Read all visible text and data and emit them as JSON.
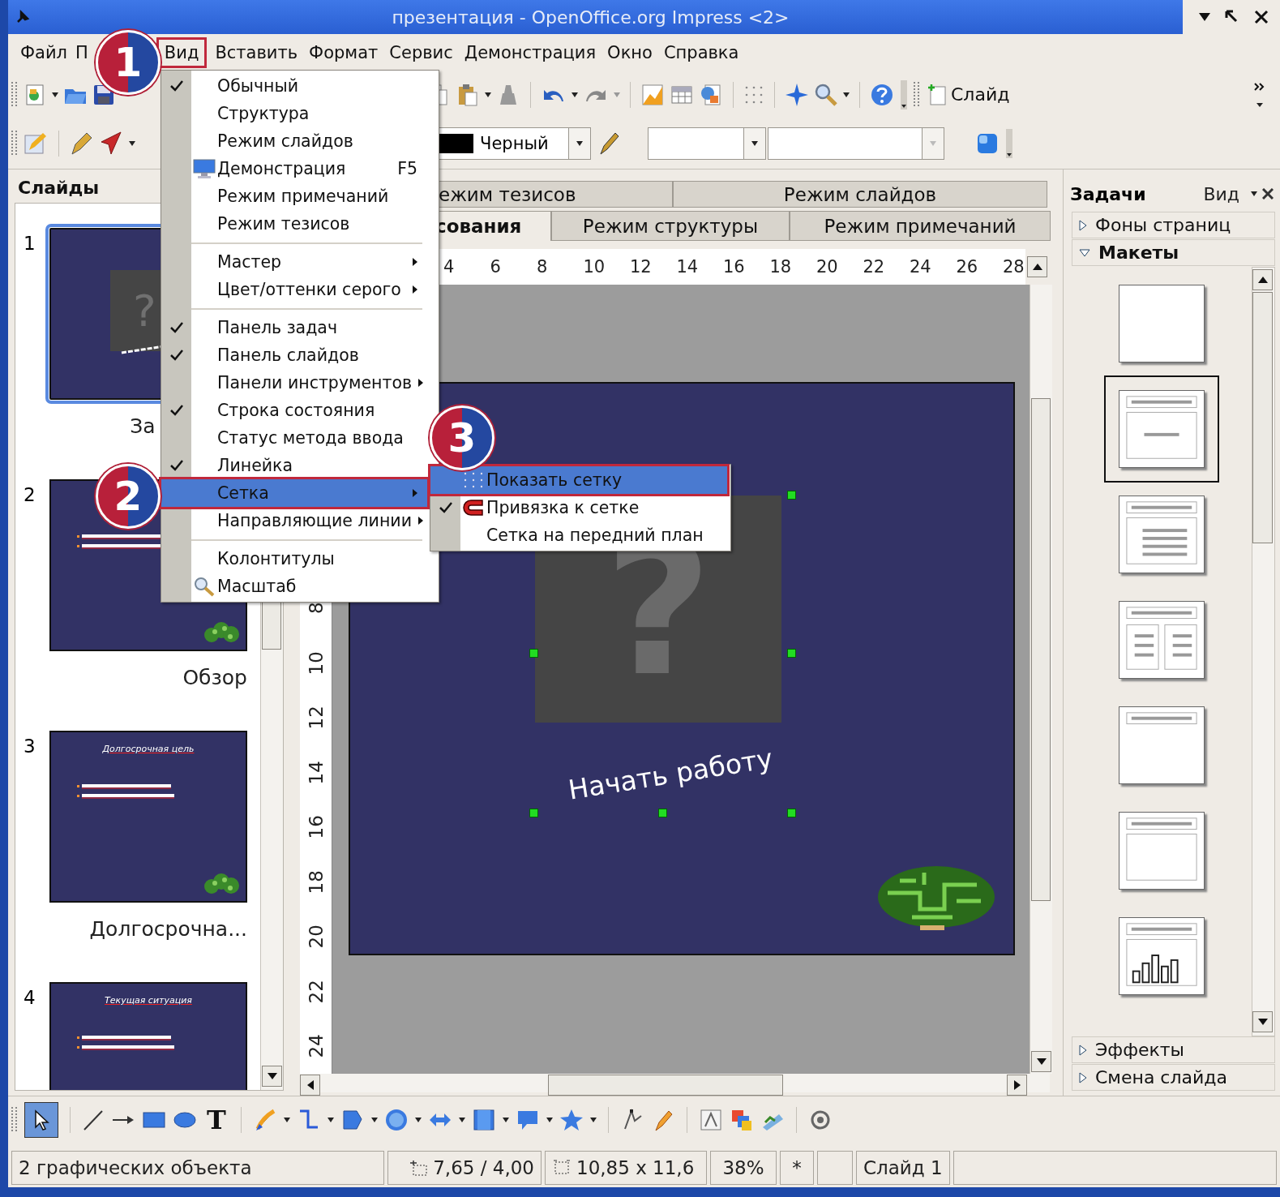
{
  "window": {
    "title": "презентация - OpenOffice.org Impress <2>"
  },
  "menubar": [
    {
      "label": "Файл",
      "annotated": false
    },
    {
      "label": "П",
      "annotated": false
    },
    {
      "label": "Вид",
      "annotated": true
    },
    {
      "label": "Вставить",
      "annotated": false
    },
    {
      "label": "Формат",
      "annotated": false
    },
    {
      "label": "Сервис",
      "annotated": false
    },
    {
      "label": "Демонстрация",
      "annotated": false
    },
    {
      "label": "Окно",
      "annotated": false
    },
    {
      "label": "Справка",
      "annotated": false
    }
  ],
  "toolbar": {
    "new_slide": "Слайд"
  },
  "format_bar": {
    "line_color": "Черный"
  },
  "slides_panel": {
    "title": "Слайды",
    "slides": [
      {
        "number": "1",
        "name": "За",
        "kind": "title",
        "placeholder": "?",
        "selected": true
      },
      {
        "number": "2",
        "name": "Обзор",
        "kind": "content",
        "selected": false
      },
      {
        "number": "3",
        "name": "Долгосрочна...",
        "kind": "content",
        "heading": "Долгосрочная цель",
        "selected": false
      },
      {
        "number": "4",
        "kind": "content",
        "heading": "Текущая ситуация",
        "selected": false
      }
    ]
  },
  "view_tabs": {
    "top": [
      {
        "label": "ежим тезисов",
        "selected": false
      },
      {
        "label": "Режим слайдов",
        "selected": false
      }
    ],
    "bottom": [
      {
        "label": "сования",
        "selected": true
      },
      {
        "label": "Режим структуры",
        "selected": false
      },
      {
        "label": "Режим примечаний",
        "selected": false
      }
    ]
  },
  "rulers": {
    "horizontal": [
      "4",
      "6",
      "8",
      "10",
      "12",
      "14",
      "16",
      "18",
      "20",
      "22",
      "24",
      "26",
      "28"
    ],
    "vertical": [
      "8",
      "10",
      "12",
      "14",
      "16",
      "18",
      "20",
      "22",
      "24"
    ]
  },
  "slide": {
    "placeholder": "?",
    "text": "Начать работу"
  },
  "tasks_panel": {
    "title": "Задачи",
    "view_menu": "Вид",
    "sections": [
      {
        "label": "Фоны страниц",
        "expanded": false
      },
      {
        "label": "Макеты",
        "expanded": true
      }
    ],
    "layouts": [
      {
        "kind": "blank",
        "selected": false
      },
      {
        "kind": "title-subtitle",
        "selected": true
      },
      {
        "kind": "title-content",
        "selected": false
      },
      {
        "kind": "title-two-content",
        "selected": false
      },
      {
        "kind": "title-only",
        "selected": false
      },
      {
        "kind": "title-box",
        "selected": false
      },
      {
        "kind": "title-chart",
        "selected": false
      }
    ],
    "bottom_sections": [
      {
        "label": "Эффекты",
        "expanded": false
      },
      {
        "label": "Смена слайда",
        "expanded": false
      }
    ]
  },
  "drawing_toolbar": {
    "select_tool": {
      "selected": true
    },
    "text_tool": "T"
  },
  "status_bar": {
    "message": "2 графических объекта",
    "position": "7,65 / 4,00",
    "size": "10,85 x 11,6",
    "zoom": "38%",
    "modified": "*",
    "slide": "Слайд 1"
  },
  "view_menu": {
    "items": [
      {
        "kind": "item",
        "label": "Обычный",
        "checked": true,
        "submenu": false,
        "selected": false,
        "annotated": false
      },
      {
        "kind": "item",
        "label": "Структура",
        "checked": false,
        "submenu": false,
        "selected": false,
        "annotated": false
      },
      {
        "kind": "item",
        "label": "Режим слайдов",
        "checked": false,
        "submenu": false,
        "selected": false,
        "annotated": false
      },
      {
        "kind": "item",
        "label": "Демонстрация",
        "shortcut": "F5",
        "checked": false,
        "submenu": false,
        "selected": false,
        "annotated": false
      },
      {
        "kind": "item",
        "label": "Режим примечаний",
        "checked": false,
        "submenu": false,
        "selected": false,
        "annotated": false
      },
      {
        "kind": "item",
        "label": "Режим тезисов",
        "checked": false,
        "submenu": false,
        "selected": false,
        "annotated": false
      },
      {
        "kind": "separator"
      },
      {
        "kind": "item",
        "label": "Мастер",
        "checked": false,
        "submenu": true,
        "selected": false,
        "annotated": false
      },
      {
        "kind": "item",
        "label": "Цвет/оттенки серого",
        "checked": false,
        "submenu": true,
        "selected": false,
        "annotated": false
      },
      {
        "kind": "separator"
      },
      {
        "kind": "item",
        "label": "Панель задач",
        "checked": true,
        "submenu": false,
        "selected": false,
        "annotated": false
      },
      {
        "kind": "item",
        "label": "Панель слайдов",
        "checked": true,
        "submenu": false,
        "selected": false,
        "annotated": false
      },
      {
        "kind": "item",
        "label": "Панели инструментов",
        "checked": false,
        "submenu": true,
        "selected": false,
        "annotated": false
      },
      {
        "kind": "item",
        "label": "Строка состояния",
        "checked": true,
        "submenu": false,
        "selected": false,
        "annotated": false
      },
      {
        "kind": "item",
        "label": "Статус метода ввода",
        "checked": false,
        "submenu": false,
        "selected": false,
        "annotated": false
      },
      {
        "kind": "item",
        "label": "Линейка",
        "checked": true,
        "submenu": false,
        "selected": false,
        "annotated": false
      },
      {
        "kind": "item",
        "label": "Сетка",
        "checked": false,
        "submenu": true,
        "selected": true,
        "annotated": true
      },
      {
        "kind": "item",
        "label": "Направляющие линии",
        "checked": false,
        "submenu": true,
        "selected": false,
        "annotated": false
      },
      {
        "kind": "separator"
      },
      {
        "kind": "item",
        "label": "Колонтитулы",
        "checked": false,
        "submenu": false,
        "selected": false,
        "annotated": false
      },
      {
        "kind": "item",
        "label": "Масштаб",
        "checked": false,
        "submenu": false,
        "selected": false,
        "annotated": false
      }
    ]
  },
  "grid_submenu": {
    "items": [
      {
        "kind": "item",
        "label": "Показать сетку",
        "checked": false,
        "submenu": false,
        "selected": true,
        "annotated": true
      },
      {
        "kind": "item",
        "label": "Привязка к сетке",
        "checked": true,
        "submenu": false,
        "selected": false,
        "annotated": false
      },
      {
        "kind": "item",
        "label": "Сетка на передний план",
        "checked": false,
        "submenu": false,
        "selected": false,
        "annotated": false
      }
    ]
  },
  "callouts": [
    "1",
    "2",
    "3"
  ]
}
